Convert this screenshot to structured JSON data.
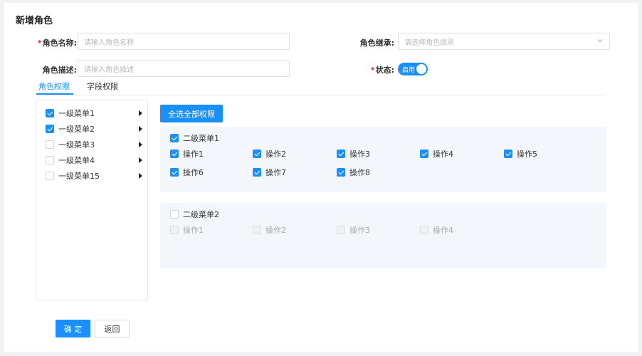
{
  "form": {
    "title": "新增角色",
    "role_name": {
      "required_mark": "*",
      "label": "角色名称:",
      "placeholder": "请输入角色名称"
    },
    "role_inherit": {
      "label": "角色继承:",
      "placeholder": "请选择角色继承"
    },
    "role_desc": {
      "label": "角色描述:",
      "placeholder": "请输入角色描述"
    },
    "status": {
      "required_mark": "*",
      "label": "状态:",
      "switch_text": "启用",
      "on": true
    }
  },
  "tabs": [
    {
      "label": "角色权限",
      "active": true
    },
    {
      "label": "字段权限",
      "active": false
    }
  ],
  "menu": [
    {
      "label": "一级菜单1",
      "checked": true
    },
    {
      "label": "一级菜单2",
      "checked": true
    },
    {
      "label": "一级菜单3",
      "checked": false
    },
    {
      "label": "一级菜单4",
      "checked": false
    },
    {
      "label": "一级菜单15",
      "checked": false
    }
  ],
  "select_all_label": "全选全部权限",
  "groups": [
    {
      "title": "二级菜单1",
      "checked": true,
      "ops": [
        {
          "label": "操作1",
          "checked": true
        },
        {
          "label": "操作2",
          "checked": true
        },
        {
          "label": "操作3",
          "checked": true
        },
        {
          "label": "操作4",
          "checked": true
        },
        {
          "label": "操作5",
          "checked": true
        },
        {
          "label": "操作6",
          "checked": true
        },
        {
          "label": "操作7",
          "checked": true
        },
        {
          "label": "操作8",
          "checked": true
        }
      ]
    },
    {
      "title": "二级菜单2",
      "checked": false,
      "ops": [
        {
          "label": "操作1",
          "checked": false
        },
        {
          "label": "操作2",
          "checked": false
        },
        {
          "label": "操作3",
          "checked": false
        },
        {
          "label": "操作4",
          "checked": false
        }
      ]
    }
  ],
  "footer": {
    "confirm_label": "确 定",
    "back_label": "返回"
  },
  "colors": {
    "primary": "#1890ff",
    "required": "#f5222d",
    "group_bg": "#f3f6fa"
  },
  "icons": {
    "select_arrow": "chevron-down-icon",
    "menu_caret": "caret-right-icon"
  }
}
